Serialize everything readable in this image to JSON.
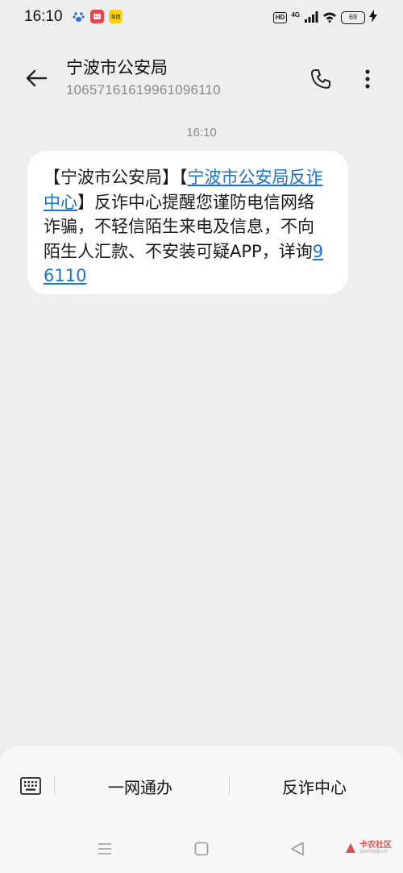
{
  "status_bar": {
    "time": "16:10",
    "hd_label": "HD",
    "network_label": "4G",
    "battery": "69",
    "notif_red_text": "",
    "notif_yellow_text": "美团"
  },
  "header": {
    "contact_name": "宁波市公安局",
    "contact_number": "10657161619961096110"
  },
  "conversation": {
    "timestamp": "16:10",
    "message": {
      "part1": "【宁波市公安局】【",
      "link1": "宁波市公安局反诈中心",
      "part2": "】反诈中心提醒您谨防电信网络诈骗，不轻信陌生来电及信息，不向陌生人汇款、不安装可疑APP，详询",
      "link2": "96110"
    }
  },
  "bottom_menu": {
    "item1": "一网通办",
    "item2": "反诈中心"
  },
  "watermark": {
    "text": "卡农社区",
    "sub": "深圳市有限公司"
  },
  "colors": {
    "background": "#eeeeef",
    "bubble": "#ffffff",
    "link": "#1873d3",
    "secondary_text": "#8a8a8a"
  }
}
